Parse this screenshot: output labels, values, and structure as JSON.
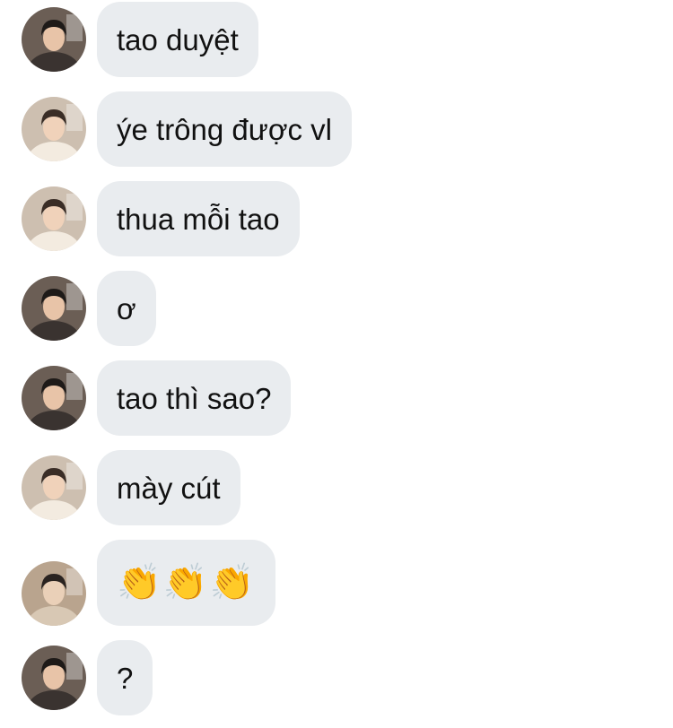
{
  "messages": [
    {
      "sender": "a",
      "text": "tao duyệt"
    },
    {
      "sender": "b",
      "text": "ýe trông được vl"
    },
    {
      "sender": "b",
      "text": "thua mỗi tao"
    },
    {
      "sender": "a",
      "text": "ơ"
    },
    {
      "sender": "a",
      "text": "tao thì sao?"
    },
    {
      "sender": "b",
      "text": "mày cút"
    },
    {
      "sender": "c",
      "text": "👏👏👏"
    },
    {
      "sender": "a",
      "text": "?"
    }
  ],
  "avatars": {
    "a": {
      "bg": "#6b5e55",
      "skin": "#e8c4a8",
      "hair": "#1e1a18",
      "shirt": "#3a3330"
    },
    "b": {
      "bg": "#cdbfb0",
      "skin": "#f0d2ba",
      "hair": "#3a2d26",
      "shirt": "#f3ebe0"
    },
    "c": {
      "bg": "#b9a48e",
      "skin": "#ead0b8",
      "hair": "#2a2320",
      "shirt": "#d8c8b4"
    }
  },
  "colors": {
    "bubble": "#e9ecef",
    "text": "#111111",
    "background": "#ffffff"
  }
}
